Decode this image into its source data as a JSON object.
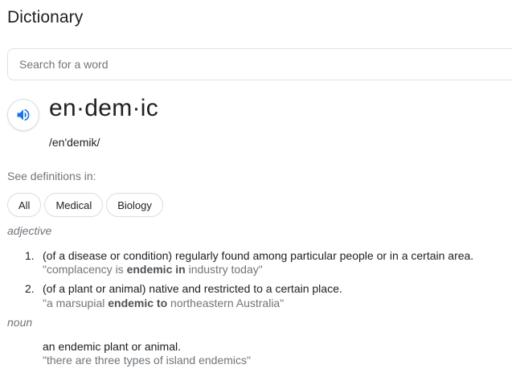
{
  "header": {
    "title": "Dictionary"
  },
  "search": {
    "placeholder": "Search for a word",
    "value": ""
  },
  "entry": {
    "speaker_icon": "speaker-icon",
    "word": "en·dem·ic",
    "phonetic": "/en'demik/"
  },
  "filters": {
    "label": "See definitions in:",
    "chips": [
      {
        "label": "All"
      },
      {
        "label": "Medical"
      },
      {
        "label": "Biology"
      }
    ]
  },
  "senses": [
    {
      "part_of_speech": "adjective",
      "definitions": [
        {
          "number": "1.",
          "text": "(of a disease or condition) regularly found among particular people or in a certain area.",
          "example_before": "\"complacency is ",
          "example_bold": "endemic in",
          "example_after": " industry today\""
        },
        {
          "number": "2.",
          "text": "(of a plant or animal) native and restricted to a certain place.",
          "example_before": "\"a marsupial ",
          "example_bold": "endemic to",
          "example_after": " northeastern Australia\""
        }
      ]
    },
    {
      "part_of_speech": "noun",
      "definitions": [
        {
          "text": "an endemic plant or animal.",
          "example": "\"there are three types of island endemics\""
        }
      ]
    }
  ],
  "colors": {
    "primary_text": "#202124",
    "secondary_text": "#70757a",
    "accent_blue": "#1a73e8",
    "border": "#dadce0"
  }
}
